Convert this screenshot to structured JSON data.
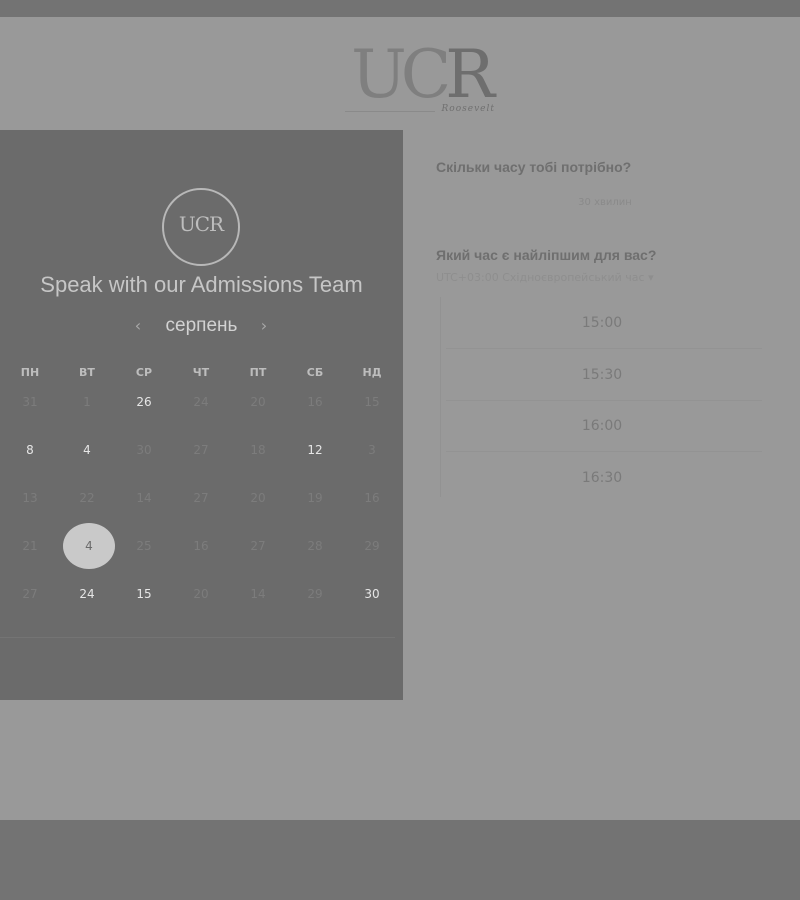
{
  "logo": {
    "mark_left": "UC",
    "mark_right": "R",
    "subtitle": "Roosevelt"
  },
  "calendar": {
    "badge_text": "UCR",
    "title": "Speak with our Admissions Team",
    "month": "серпень",
    "prev_icon": "chevron-left-icon",
    "next_icon": "chevron-right-icon",
    "prev_glyph": "‹",
    "next_glyph": "›",
    "weekdays": [
      "ПН",
      "ВТ",
      "СР",
      "ЧТ",
      "ПТ",
      "СБ",
      "НД"
    ],
    "weeks": [
      [
        {
          "label": "31",
          "available": false
        },
        {
          "label": "1",
          "available": false
        },
        {
          "label": "26",
          "available": true
        },
        {
          "label": "24",
          "available": false
        },
        {
          "label": "20",
          "available": false
        },
        {
          "label": "16",
          "available": false
        },
        {
          "label": "15",
          "available": false
        }
      ],
      [
        {
          "label": "8",
          "available": true
        },
        {
          "label": "4",
          "available": true
        },
        {
          "label": "30",
          "available": false
        },
        {
          "label": "27",
          "available": false
        },
        {
          "label": "18",
          "available": false
        },
        {
          "label": "12",
          "available": true
        },
        {
          "label": "3",
          "available": false
        }
      ],
      [
        {
          "label": "13",
          "available": false
        },
        {
          "label": "22",
          "available": false
        },
        {
          "label": "14",
          "available": false
        },
        {
          "label": "27",
          "available": false
        },
        {
          "label": "20",
          "available": false
        },
        {
          "label": "19",
          "available": false
        },
        {
          "label": "16",
          "available": false
        }
      ],
      [
        {
          "label": "21",
          "available": false
        },
        {
          "label": "4",
          "available": true,
          "selected": true
        },
        {
          "label": "25",
          "available": false
        },
        {
          "label": "16",
          "available": false
        },
        {
          "label": "27",
          "available": false
        },
        {
          "label": "28",
          "available": false
        },
        {
          "label": "29",
          "available": false
        }
      ],
      [
        {
          "label": "27",
          "available": false
        },
        {
          "label": "24",
          "available": true
        },
        {
          "label": "15",
          "available": true
        },
        {
          "label": "20",
          "available": false
        },
        {
          "label": "14",
          "available": false
        },
        {
          "label": "29",
          "available": false
        },
        {
          "label": "30",
          "available": true
        }
      ]
    ]
  },
  "booking": {
    "duration_question": "Скільки часу тобі потрібно?",
    "duration_value": "30 хвилин",
    "time_question": "Який час є найліпшим для вас?",
    "timezone_label": "UTC+03:00 Східноєвропейський час ▾",
    "slots": [
      "15:00",
      "15:30",
      "16:00",
      "16:30"
    ]
  },
  "colors": {
    "overlay": "#999999",
    "panel": "#6b6b6b",
    "bottom_band": "#737373"
  }
}
